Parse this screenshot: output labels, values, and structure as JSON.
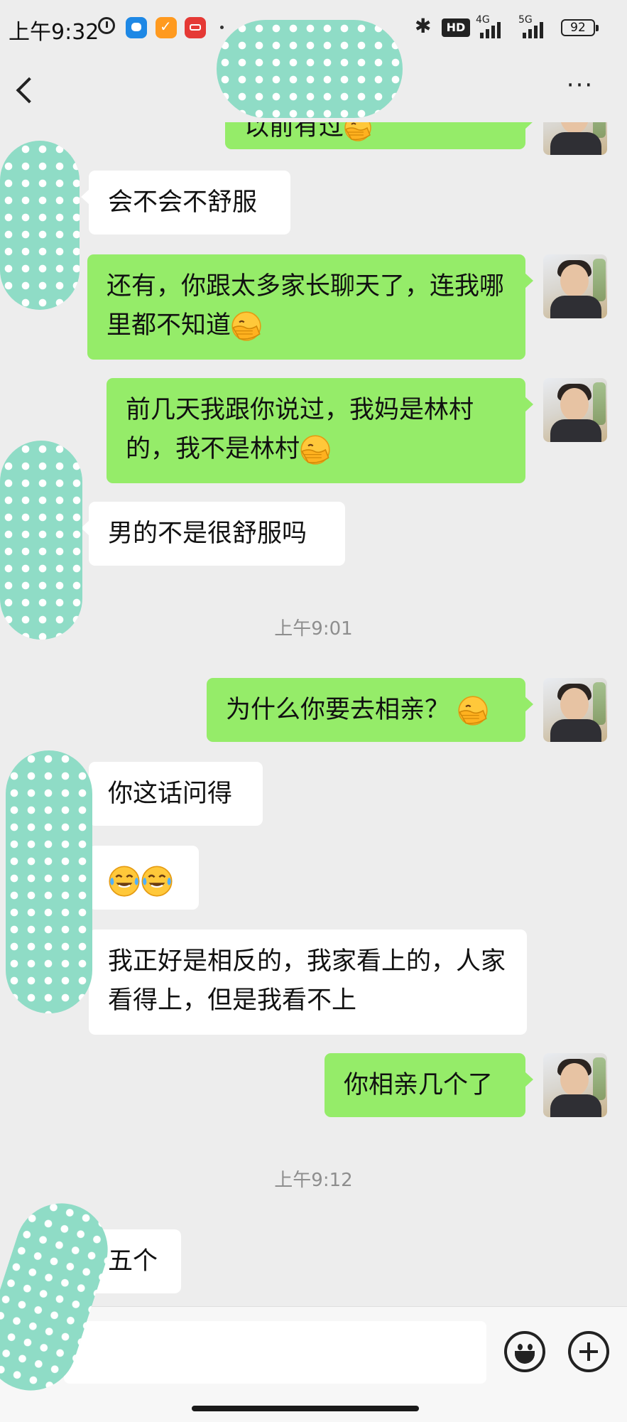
{
  "status_bar": {
    "time": "上午9:32",
    "bluetooth": "✱",
    "hd": "HD",
    "net1": "4G",
    "net2": "5G",
    "battery": "92"
  },
  "header": {
    "title": "",
    "more": "···"
  },
  "timestamps": [
    "上午9:01",
    "上午9:12"
  ],
  "messages": [
    {
      "side": "right",
      "text": "以前有过",
      "emoji_after": true
    },
    {
      "side": "left",
      "text": "会不会不舒服"
    },
    {
      "side": "right",
      "text": "还有，你跟太多家长聊天了，连我哪里都不知道"
    },
    {
      "side": "right",
      "text": "前几天我跟你说过，我妈是林村的，我不是林村"
    },
    {
      "side": "left",
      "text": "男的不是很舒服吗"
    },
    {
      "side": "right",
      "text": "为什么你要去相亲？"
    },
    {
      "side": "left",
      "text": "你这话问得"
    },
    {
      "side": "left",
      "text": ""
    },
    {
      "side": "left",
      "text": "我正好是相反的，我家看上的，人家看得上，但是我看不上"
    },
    {
      "side": "right",
      "text": "你相亲几个了"
    },
    {
      "side": "left",
      "text": "五个"
    }
  ],
  "icons": {
    "back": "chevron-left-icon",
    "more": "more-dots-icon",
    "emoji": "emoji-icon",
    "plus": "plus-icon",
    "facepalm": "facepalm-emoji",
    "laugh": "tears-of-joy-emoji"
  },
  "colors": {
    "background": "#ededed",
    "outgoing": "#95ec69",
    "incoming": "#ffffff",
    "privacy_mask": "#8fdcc6"
  }
}
